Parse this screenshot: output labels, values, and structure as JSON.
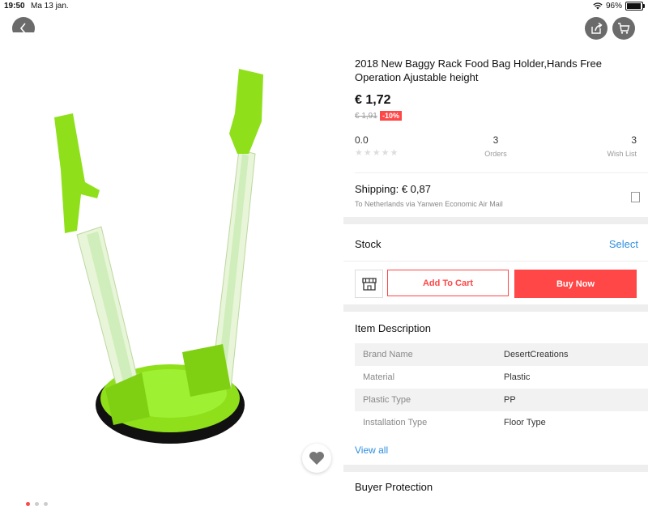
{
  "status_bar": {
    "time": "19:50",
    "date": "Ma 13 jan.",
    "battery": "96%",
    "battery_level": 0.96
  },
  "header": {
    "back_icon": "chevron-left-icon",
    "share_icon": "share-icon",
    "cart_icon": "cart-icon"
  },
  "gallery": {
    "image_count": 3,
    "active_index": 0,
    "favorite_icon": "heart-icon"
  },
  "product": {
    "title": "2018 New Baggy Rack Food Bag Holder,Hands Free Operation Ajustable height",
    "price": "€ 1,72",
    "old_price": "€ 1,91",
    "discount": "-10%"
  },
  "stats": {
    "rating": "0.0",
    "rating_stars": 0,
    "orders_count": "3",
    "orders_label": "Orders",
    "wishlist_count": "3",
    "wishlist_label": "Wish List"
  },
  "shipping": {
    "title": "Shipping: € 0,87",
    "subtitle": "To Netherlands via Yanwen Economic Air Mail"
  },
  "stock": {
    "label": "Stock",
    "select_label": "Select"
  },
  "actions": {
    "store_icon": "store-icon",
    "add_to_cart": "Add To Cart",
    "buy_now": "Buy Now"
  },
  "description": {
    "title": "Item Description",
    "specs": [
      {
        "key": "Brand Name",
        "value": "DesertCreations"
      },
      {
        "key": "Material",
        "value": "Plastic"
      },
      {
        "key": "Plastic Type",
        "value": "PP"
      },
      {
        "key": "Installation Type",
        "value": "Floor Type"
      }
    ],
    "view_all": "View all"
  },
  "next_section": {
    "title": "Buyer Protection"
  },
  "colors": {
    "accent": "#ff4747",
    "link": "#2f8fe0",
    "product_green": "#8fe01a"
  }
}
